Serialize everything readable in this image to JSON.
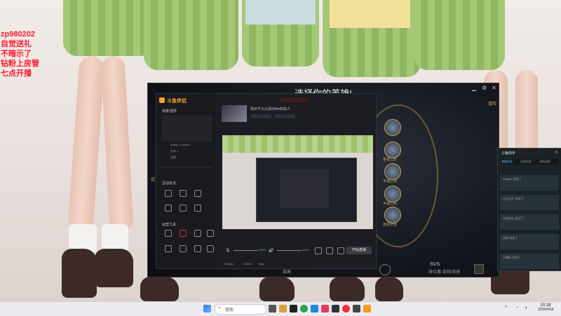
{
  "overlay": {
    "lines": [
      "zp980202",
      "自觉送礼",
      "不暗示了",
      "钻粉上房管",
      "七点开播"
    ]
  },
  "game": {
    "title": "选择你的英雄!",
    "label_left": "冠",
    "label_right": "冒险",
    "mode_label": "SVS",
    "mode_sub": "排位赛 单排/双排",
    "hero_labels": [
      "荒芜之影",
      "丰城之荷",
      "不破之斩",
      "熔岩巨兽"
    ],
    "chat_input_hint": "单高"
  },
  "app": {
    "name": "斗鱼伴侣",
    "section_header": "场景/插件",
    "scene_items": [
      "Bongo Cat Mve...",
      "文本 1",
      "边框"
    ],
    "section_tools": "互动玩法",
    "section_plugins": "运营工具",
    "room_title": "杭州千九以及999w好的人",
    "preview_zoom_1": "100%",
    "preview_zoom_2": "101%",
    "start_live": "开始直播",
    "stats": [
      "0.0kbps",
      "0.00%",
      "0fps"
    ]
  },
  "chat": {
    "title": "斗鱼助手",
    "tabs": [
      "弹幕消息",
      "礼物消息",
      "进场消息"
    ],
    "messages": [
      "598881 进来了",
      "火力全开 进来了",
      "自觉送礼 送出了",
      "钻粉 进来了",
      "开播啦 进来了"
    ]
  },
  "taskbar": {
    "search_placeholder": "搜索",
    "time": "20:28",
    "date": "2025/4/18"
  }
}
